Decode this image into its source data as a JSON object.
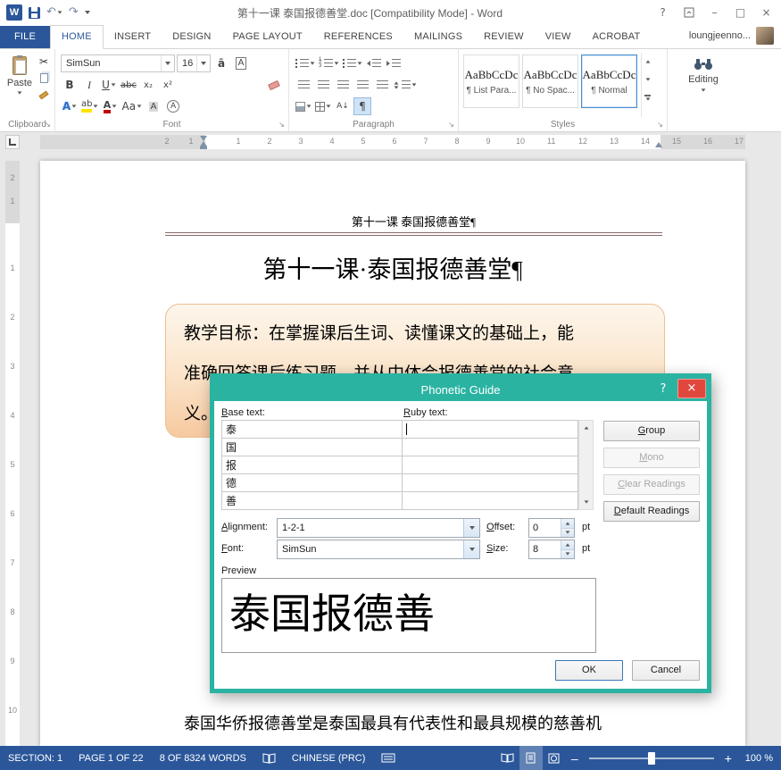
{
  "titlebar": {
    "title": "第十一课 泰国报德善堂.doc [Compatibility Mode] - Word"
  },
  "tabs": {
    "file": "FILE",
    "items": [
      "HOME",
      "INSERT",
      "DESIGN",
      "PAGE LAYOUT",
      "REFERENCES",
      "MAILINGS",
      "REVIEW",
      "VIEW",
      "ACROBAT"
    ],
    "user": "loungjeenno..."
  },
  "ribbon": {
    "clipboard": {
      "label": "Clipboard",
      "paste": "Paste"
    },
    "font": {
      "label": "Font",
      "name": "SimSun",
      "size": "16"
    },
    "paragraph": {
      "label": "Paragraph"
    },
    "styles": {
      "label": "Styles",
      "cards": [
        {
          "sample": "AaBbCcDc",
          "name": "¶ List Para..."
        },
        {
          "sample": "AaBbCcDc",
          "name": "¶ No Spac..."
        },
        {
          "sample": "AaBbCcDc",
          "name": "¶ Normal"
        }
      ]
    },
    "editing": {
      "label": "Editing"
    }
  },
  "glyphs": {
    "cut": "✂",
    "undo": "↶",
    "redo": "↷",
    "bold": "B",
    "italic": "I",
    "underline": "U",
    "strikethrough": "abc",
    "subscript": "x₂",
    "superscript": "x²",
    "text_effects": "A",
    "highlight": "ab",
    "font_color": "A",
    "change_case": "Aa",
    "char_shading": "A",
    "enclose_char": "A",
    "char_border": "A",
    "phonetic_guide": "ā",
    "pilcrow": "¶",
    "sort": "A↓",
    "help": "?",
    "minimize": "–",
    "maximize": "□",
    "close": "×"
  },
  "ruler": {
    "h_margin": [
      "2",
      "1"
    ],
    "h_numbers": [
      "1",
      "2",
      "3",
      "4",
      "5",
      "6",
      "7",
      "8",
      "9",
      "10",
      "11",
      "12",
      "13",
      "14",
      "15",
      "16",
      "17"
    ],
    "v_margin": [
      "2",
      "1"
    ],
    "v_numbers": [
      "1",
      "2",
      "3",
      "4",
      "5",
      "6",
      "7",
      "8",
      "9",
      "10"
    ]
  },
  "document": {
    "header": "第十一课 泰国报德善堂¶",
    "title": "第十一课·泰国报德善堂¶",
    "objective": [
      "教学目标：在掌握课后生词、读懂课文的基础上，能",
      "准确回答课后练习题，并从中体会报德善堂的社会意",
      "义。"
    ],
    "body": "泰国华侨报德善堂是泰国最具有代表性和最具规模的慈善机"
  },
  "dialog": {
    "title": "Phonetic Guide",
    "base_label": "<u>B</u>ase text:",
    "ruby_label": "<u>R</u>uby text:",
    "rows": [
      {
        "base": "泰",
        "ruby": ""
      },
      {
        "base": "国",
        "ruby": ""
      },
      {
        "base": "报",
        "ruby": ""
      },
      {
        "base": "德",
        "ruby": ""
      },
      {
        "base": "善",
        "ruby": ""
      }
    ],
    "group_btn": "<u>G</u>roup",
    "mono_btn": "<u>M</u>ono",
    "clear_btn": "<u>C</u>lear Readings",
    "default_btn": "<u>D</u>efault Readings",
    "alignment_label": "<u>A</u>lignment:",
    "alignment_value": "1-2-1",
    "offset_label": "<u>O</u>ffset:",
    "offset_value": "0",
    "offset_unit": "pt",
    "font_label": "<u>F</u>ont:",
    "font_value": "SimSun",
    "size_label": "<u>S</u>ize:",
    "size_value": "8",
    "size_unit": "pt",
    "preview_label": "Preview",
    "preview_text": "泰国报德善",
    "ok": "OK",
    "cancel": "Cancel"
  },
  "statusbar": {
    "section": "SECTION: 1",
    "page": "PAGE 1 OF 22",
    "words": "8 OF 8324 WORDS",
    "language": "CHINESE (PRC)",
    "zoom": "100 %"
  }
}
